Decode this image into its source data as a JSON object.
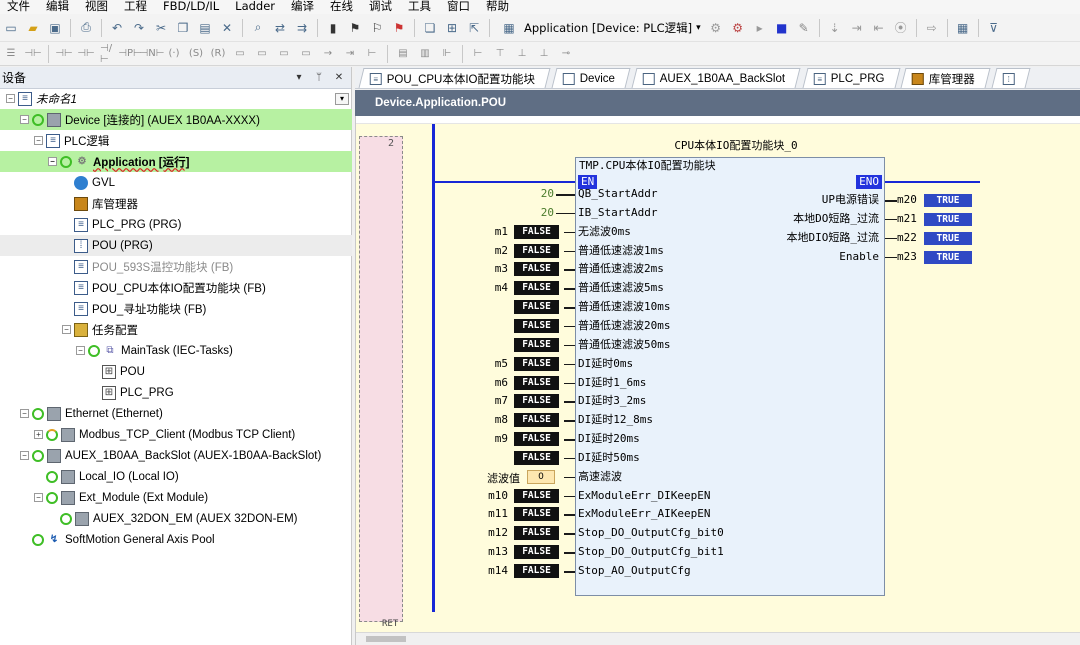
{
  "menu": [
    "文件",
    "编辑",
    "视图",
    "工程",
    "FBD/LD/IL",
    "Ladder",
    "编译",
    "在线",
    "调试",
    "工具",
    "窗口",
    "帮助"
  ],
  "toolbar": {
    "application_combo": "Application [Device: PLC逻辑]"
  },
  "devices_pane": {
    "title": "设备",
    "pin_label": "ᛘ",
    "close_label": "✕"
  },
  "tree": [
    {
      "label": "未命名1",
      "level": 0,
      "icon": "doc-icon"
    },
    {
      "label": "Device [连接的] (AUEX 1B0AA-XXXX)",
      "level": 1,
      "icon": "device-icon",
      "status": "online"
    },
    {
      "label": "PLC逻辑",
      "level": 2,
      "icon": "plc-logic-icon"
    },
    {
      "label": "Application [运行]",
      "level": 3,
      "icon": "gear-icon",
      "status": "running"
    },
    {
      "label": "GVL",
      "level": 4,
      "icon": "globe-icon"
    },
    {
      "label": "库管理器",
      "level": 4,
      "icon": "library-icon"
    },
    {
      "label": "PLC_PRG (PRG)",
      "level": 4,
      "icon": "doc-icon"
    },
    {
      "label": "POU (PRG)",
      "level": 4,
      "icon": "pou-icon"
    },
    {
      "label": "POU_593S温控功能块 (FB)",
      "level": 4,
      "icon": "doc-icon"
    },
    {
      "label": "POU_CPU本体IO配置功能块 (FB)",
      "level": 4,
      "icon": "doc-icon"
    },
    {
      "label": "POU_寻址功能块 (FB)",
      "level": 4,
      "icon": "doc-icon"
    },
    {
      "label": "任务配置",
      "level": 4,
      "icon": "task-config-icon"
    },
    {
      "label": "MainTask (IEC-Tasks)",
      "level": 5,
      "icon": "task-stack-icon",
      "status": "online"
    },
    {
      "label": "POU",
      "level": 6,
      "icon": "program-call-icon"
    },
    {
      "label": "PLC_PRG",
      "level": 6,
      "icon": "program-call-icon"
    },
    {
      "label": "Ethernet (Ethernet)",
      "level": 1,
      "icon": "device-icon",
      "status": "online"
    },
    {
      "label": "Modbus_TCP_Client (Modbus TCP Client)",
      "level": 2,
      "icon": "device-icon",
      "status": "partial"
    },
    {
      "label": "AUEX_1B0AA_BackSlot (AUEX-1B0AA-BackSlot)",
      "level": 1,
      "icon": "device-icon",
      "status": "online"
    },
    {
      "label": "Local_IO (Local IO)",
      "level": 2,
      "icon": "device-icon",
      "status": "online"
    },
    {
      "label": "Ext_Module (Ext Module)",
      "level": 2,
      "icon": "device-icon",
      "status": "online"
    },
    {
      "label": "AUEX_32DON_EM (AUEX 32DON-EM)",
      "level": 3,
      "icon": "device-icon",
      "status": "online"
    },
    {
      "label": "SoftMotion General Axis Pool",
      "level": 1,
      "icon": "axis-pool-icon",
      "status": "online"
    }
  ],
  "tabs": [
    {
      "label": "POU_CPU本体IO配置功能块",
      "icon": "doc-icon"
    },
    {
      "label": "Device",
      "icon": "device-icon"
    },
    {
      "label": "AUEX_1B0AA_BackSlot",
      "icon": "device-icon"
    },
    {
      "label": "PLC_PRG",
      "icon": "doc-icon"
    },
    {
      "label": "库管理器",
      "icon": "library-icon"
    }
  ],
  "editor": {
    "path": "Device.Application.POU",
    "network_number": "2",
    "instance_name": "CPU本体IO配置功能块_0",
    "fb_type": "TMP.CPU本体IO配置功能块",
    "en_label": "EN",
    "eno_label": "ENO",
    "ret_label": "RET",
    "inputs": [
      {
        "pin": "QB_StartAddr",
        "const": "20"
      },
      {
        "pin": "IB_StartAddr",
        "const": "20"
      },
      {
        "pin": "无滤波0ms",
        "var": "m1",
        "value": "FALSE"
      },
      {
        "pin": "普通低速滤波1ms",
        "var": "m2",
        "value": "FALSE"
      },
      {
        "pin": "普通低速滤波2ms",
        "var": "m3",
        "value": "FALSE"
      },
      {
        "pin": "普通低速滤波5ms",
        "var": "m4",
        "value": "FALSE"
      },
      {
        "pin": "普通低速滤波10ms",
        "value": "FALSE"
      },
      {
        "pin": "普通低速滤波20ms",
        "value": "FALSE"
      },
      {
        "pin": "普通低速滤波50ms",
        "value": "FALSE"
      },
      {
        "pin": "DI延时0ms",
        "var": "m5",
        "value": "FALSE"
      },
      {
        "pin": "DI延时1_6ms",
        "var": "m6",
        "value": "FALSE"
      },
      {
        "pin": "DI延时3_2ms",
        "var": "m7",
        "value": "FALSE"
      },
      {
        "pin": "DI延时12_8ms",
        "var": "m8",
        "value": "FALSE"
      },
      {
        "pin": "DI延时20ms",
        "var": "m9",
        "value": "FALSE"
      },
      {
        "pin": "DI延时50ms",
        "value": "FALSE"
      },
      {
        "pin": "高速滤波",
        "var": "滤波值",
        "value": "0",
        "kind": "number"
      },
      {
        "pin": "ExModuleErr_DIKeepEN",
        "var": "m10",
        "value": "FALSE"
      },
      {
        "pin": "ExModuleErr_AIKeepEN",
        "var": "m11",
        "value": "FALSE"
      },
      {
        "pin": "Stop_DO_OutputCfg_bit0",
        "var": "m12",
        "value": "FALSE"
      },
      {
        "pin": "Stop_DO_OutputCfg_bit1",
        "var": "m13",
        "value": "FALSE"
      },
      {
        "pin": "Stop_AO_OutputCfg",
        "var": "m14",
        "value": "FALSE"
      }
    ],
    "outputs": [
      {
        "pin": "UP电源错误",
        "var": "m20",
        "value": "TRUE"
      },
      {
        "pin": "本地DO短路_过流",
        "var": "m21",
        "value": "TRUE"
      },
      {
        "pin": "本地DIO短路_过流",
        "var": "m22",
        "value": "TRUE"
      },
      {
        "pin": "Enable",
        "var": "m23",
        "value": "TRUE"
      }
    ]
  },
  "colors": {
    "online_green": "#3fbe26",
    "highlight_green": "#b7f1a2",
    "path_bar": "#5f6e84",
    "editor_bg": "#fffcdc",
    "true_blue": "#2f49c4",
    "false_black": "#111111",
    "rail_blue": "#1727d6"
  }
}
